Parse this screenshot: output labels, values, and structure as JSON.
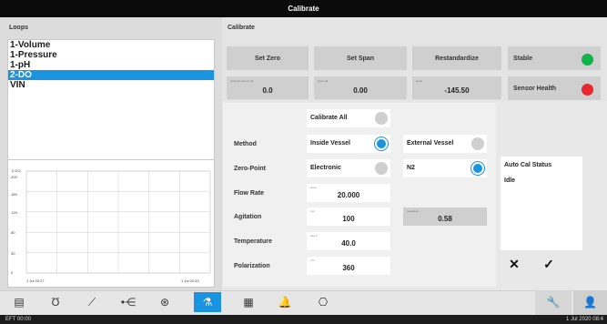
{
  "window": {
    "title": "Calibrate"
  },
  "loops": {
    "header": "Loops",
    "items": [
      "1-Volume",
      "1-Pressure",
      "1-pH",
      "2-DO",
      "VIN"
    ],
    "selected_index": 3
  },
  "chart_data": {
    "type": "line",
    "title": "",
    "ylabel": "2-DO",
    "y_ticks": [
      "200",
      "160",
      "120",
      "80",
      "40",
      "0"
    ],
    "ylim": [
      0,
      200
    ],
    "x_start_label": "1 Jul 00:27",
    "x_end_label": "1 Jul 00:43",
    "series": [
      {
        "values": []
      }
    ]
  },
  "calibrate": {
    "header": "Calibrate",
    "buttons": {
      "set_zero": "Set Zero",
      "set_span": "Set Span",
      "restandardize": "Restandardize"
    },
    "readings": [
      {
        "caption": "external source val",
        "value": "0.0"
      },
      {
        "caption": "span val",
        "value": "0.00"
      },
      {
        "caption": "slope",
        "value": "-145.50"
      }
    ],
    "status": [
      {
        "label": "Stable",
        "color": "#12b44a"
      },
      {
        "label": "Sensor Health",
        "color": "#e8282e"
      }
    ],
    "calibrate_all": "Calibrate All",
    "method": {
      "label": "Method",
      "opt1": "Inside Vessel",
      "opt2": "External Vessel"
    },
    "zero_point": {
      "label": "Zero-Point",
      "opt1": "Electronic",
      "opt2": "N2"
    },
    "flow_rate": {
      "label": "Flow Rate",
      "caption": "sccm",
      "value": "20.000"
    },
    "agitation": {
      "label": "Agitation",
      "caption": "rpm",
      "value": "100",
      "extra_caption": "saturation",
      "extra_value": "0.58"
    },
    "temperature": {
      "label": "Temperature",
      "caption": "deg C",
      "value": "40.0"
    },
    "polarization": {
      "label": "Polarization",
      "caption": "mV",
      "value": "360"
    },
    "auto_cal": {
      "title": "Auto Cal Status",
      "state": "Idle"
    },
    "cancel_symbol": "✕",
    "confirm_symbol": "✓"
  },
  "toolbar": {
    "icons": [
      {
        "name": "document-icon",
        "glyph": "▤"
      },
      {
        "name": "vessel-icon",
        "glyph": "Ʊ"
      },
      {
        "name": "trend-icon",
        "glyph": "⟋"
      },
      {
        "name": "network-icon",
        "glyph": "•⋲"
      },
      {
        "name": "pump-icon",
        "glyph": "⊛"
      },
      {
        "name": "calibrate-icon",
        "glyph": "⚗"
      },
      {
        "name": "equipment-icon",
        "glyph": "▦"
      },
      {
        "name": "alarm-bell-icon",
        "glyph": "🔔"
      },
      {
        "name": "gauge-icon",
        "glyph": "⎔"
      }
    ],
    "active_index": 5,
    "wrench_glyph": "🔧",
    "user_glyph": "👤"
  },
  "statusbar": {
    "left": "EFT 00:00",
    "right": "1 Jul 2020 08:4"
  }
}
